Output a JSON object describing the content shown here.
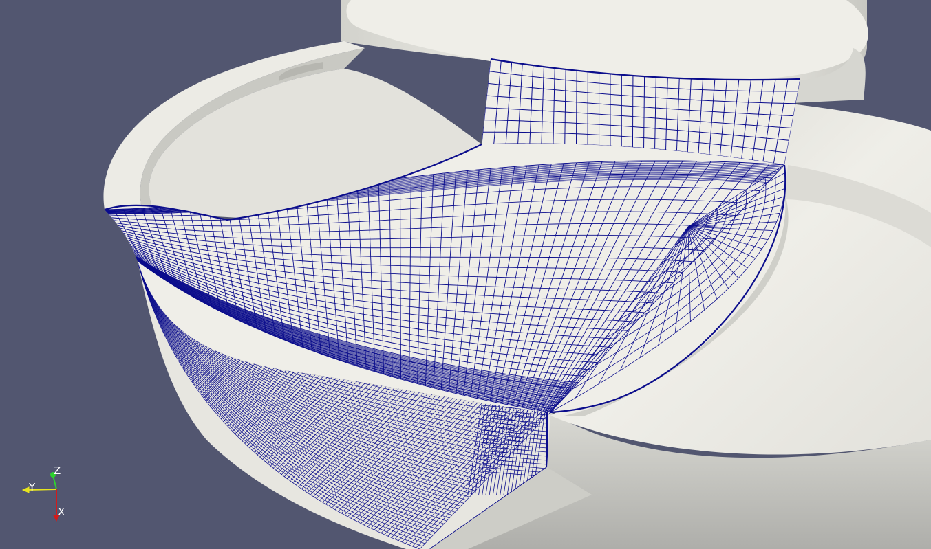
{
  "viewport": {
    "background": "#525670",
    "surface_color": "#efeee8",
    "surface_shade": "#b9b9b4",
    "mesh_color": "#0b0d8c"
  },
  "orientation_axes": {
    "labels": {
      "z": "Z",
      "y": "Y",
      "x": "X"
    },
    "colors": {
      "z": "#2fd12f",
      "y": "#e7e41f",
      "x": "#d21b1b"
    }
  }
}
